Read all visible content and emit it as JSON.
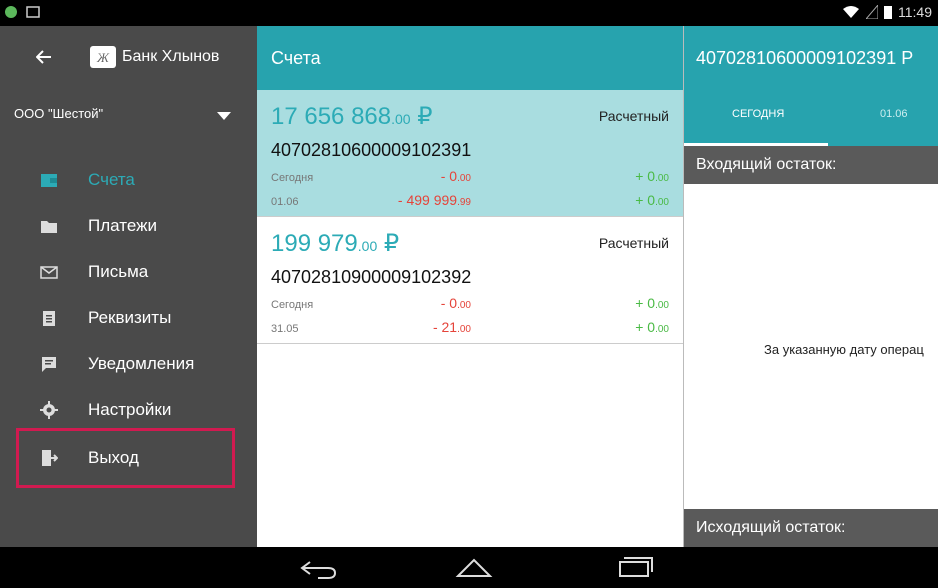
{
  "status_bar": {
    "time": "11:49"
  },
  "drawer": {
    "back_icon": "arrow-left-icon",
    "app_title": "Банк Хлынов",
    "org_name": "ООО \"Шестой\"",
    "items": [
      {
        "label": "Счета",
        "icon": "wallet-icon",
        "active": true
      },
      {
        "label": "Платежи",
        "icon": "folder-icon"
      },
      {
        "label": "Письма",
        "icon": "mail-icon"
      },
      {
        "label": "Реквизиты",
        "icon": "clipboard-icon"
      },
      {
        "label": "Уведомления",
        "icon": "message-icon"
      },
      {
        "label": "Настройки",
        "icon": "gear-icon"
      },
      {
        "label": "Выход",
        "icon": "exit-icon"
      }
    ],
    "highlight_color": "#d11a50"
  },
  "accounts_pane": {
    "title": "Счета",
    "accounts": [
      {
        "amount_main": "17 656 868",
        "amount_cents": ".00",
        "currency": "₽",
        "type": "Расчетный",
        "number": "40702810600009102391",
        "rows": [
          {
            "label": "Сегодня",
            "minus": "- 0",
            "minus_cents": ".00",
            "plus": "+ 0",
            "plus_cents": ".00"
          },
          {
            "label": "01.06",
            "minus": "- 499 999",
            "minus_cents": ".99",
            "plus": "+ 0",
            "plus_cents": ".00"
          }
        ]
      },
      {
        "amount_main": "199 979",
        "amount_cents": ".00",
        "currency": "₽",
        "type": "Расчетный",
        "number": "40702810900009102392",
        "rows": [
          {
            "label": "Сегодня",
            "minus": "- 0",
            "minus_cents": ".00",
            "plus": "+ 0",
            "plus_cents": ".00"
          },
          {
            "label": "31.05",
            "minus": "- 21",
            "minus_cents": ".00",
            "plus": "+ 0",
            "plus_cents": ".00"
          }
        ]
      }
    ]
  },
  "detail_pane": {
    "title": "40702810600009102391 Р",
    "tabs": [
      {
        "label": "СЕГОДНЯ"
      },
      {
        "label": "01.06"
      }
    ],
    "opening_label": "Входящий остаток:",
    "empty_text": "За указанную дату операц",
    "closing_label": "Исходящий остаток:"
  },
  "colors": {
    "accent": "#27a3ae",
    "selected": "#a9dde0",
    "minus": "#e5443a",
    "plus": "#4aba45"
  }
}
